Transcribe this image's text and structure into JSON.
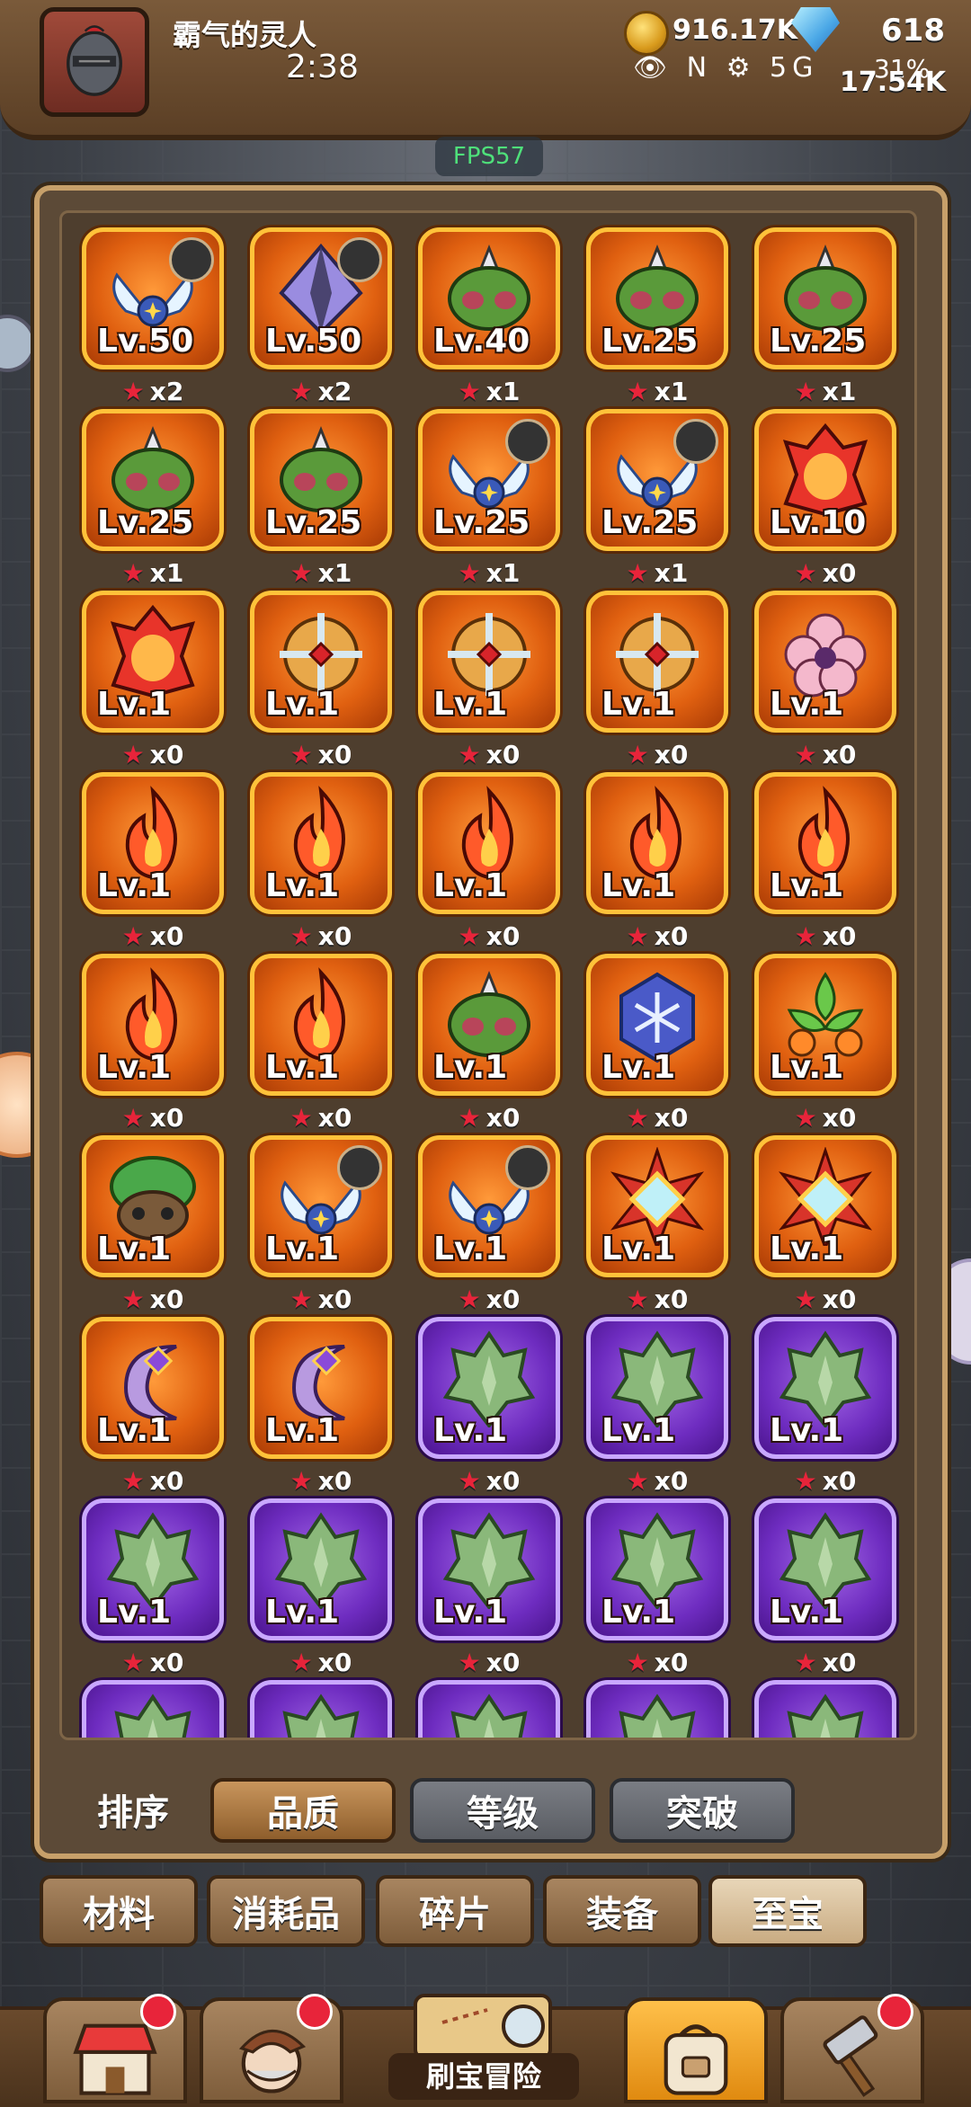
{
  "header": {
    "player_name": "霸气的灵人",
    "clock": "2:38",
    "gold": "916.17K",
    "gems": "618",
    "sub_resource": "17.54K",
    "status_icons": "👁 N ⚙ 5G",
    "battery": "31%"
  },
  "fps": "FPS57",
  "items": [
    {
      "lv": "Lv.50",
      "count": "x2",
      "rarity": "orange",
      "icon": "wing-relic-icon",
      "owner": true
    },
    {
      "lv": "Lv.50",
      "count": "x2",
      "rarity": "orange",
      "icon": "crystal-relic-icon",
      "owner": true
    },
    {
      "lv": "Lv.40",
      "count": "x1",
      "rarity": "orange",
      "icon": "green-mask-relic-icon",
      "owner": false
    },
    {
      "lv": "Lv.25",
      "count": "x1",
      "rarity": "orange",
      "icon": "green-mask-relic-icon",
      "owner": false
    },
    {
      "lv": "Lv.25",
      "count": "x1",
      "rarity": "orange",
      "icon": "green-mask-relic-icon",
      "owner": false
    },
    {
      "lv": "Lv.25",
      "count": "x1",
      "rarity": "orange",
      "icon": "green-mask-relic-icon",
      "owner": false
    },
    {
      "lv": "Lv.25",
      "count": "x1",
      "rarity": "orange",
      "icon": "green-mask-relic-icon",
      "owner": false
    },
    {
      "lv": "Lv.25",
      "count": "x1",
      "rarity": "orange",
      "icon": "wing-relic-icon",
      "owner": true
    },
    {
      "lv": "Lv.25",
      "count": "x1",
      "rarity": "orange",
      "icon": "wing-relic-icon",
      "owner": true
    },
    {
      "lv": "Lv.10",
      "count": "x0",
      "rarity": "orange",
      "icon": "flame-mask-relic-icon",
      "owner": false
    },
    {
      "lv": "Lv.1",
      "count": "x0",
      "rarity": "orange",
      "icon": "flame-mask-relic-icon",
      "owner": false
    },
    {
      "lv": "Lv.1",
      "count": "x0",
      "rarity": "orange",
      "icon": "cross-shield-relic-icon",
      "owner": false
    },
    {
      "lv": "Lv.1",
      "count": "x0",
      "rarity": "orange",
      "icon": "cross-shield-relic-icon",
      "owner": false
    },
    {
      "lv": "Lv.1",
      "count": "x0",
      "rarity": "orange",
      "icon": "cross-shield-relic-icon",
      "owner": false
    },
    {
      "lv": "Lv.1",
      "count": "x0",
      "rarity": "orange",
      "icon": "flower-relic-icon",
      "owner": false
    },
    {
      "lv": "Lv.1",
      "count": "x0",
      "rarity": "orange",
      "icon": "fire-relic-icon",
      "owner": false
    },
    {
      "lv": "Lv.1",
      "count": "x0",
      "rarity": "orange",
      "icon": "fire-relic-icon",
      "owner": false
    },
    {
      "lv": "Lv.1",
      "count": "x0",
      "rarity": "orange",
      "icon": "fire-relic-icon",
      "owner": false
    },
    {
      "lv": "Lv.1",
      "count": "x0",
      "rarity": "orange",
      "icon": "fire-relic-icon",
      "owner": false
    },
    {
      "lv": "Lv.1",
      "count": "x0",
      "rarity": "orange",
      "icon": "fire-relic-icon",
      "owner": false
    },
    {
      "lv": "Lv.1",
      "count": "x0",
      "rarity": "orange",
      "icon": "fire-relic-icon",
      "owner": false
    },
    {
      "lv": "Lv.1",
      "count": "x0",
      "rarity": "orange",
      "icon": "fire-relic-icon",
      "owner": false
    },
    {
      "lv": "Lv.1",
      "count": "x0",
      "rarity": "orange",
      "icon": "green-mask-relic-icon",
      "owner": false
    },
    {
      "lv": "Lv.1",
      "count": "x0",
      "rarity": "orange",
      "icon": "snowflake-relic-icon",
      "owner": false
    },
    {
      "lv": "Lv.1",
      "count": "x0",
      "rarity": "orange",
      "icon": "leaf-orb-relic-icon",
      "owner": false
    },
    {
      "lv": "Lv.1",
      "count": "x0",
      "rarity": "orange",
      "icon": "forest-mask-relic-icon",
      "owner": false
    },
    {
      "lv": "Lv.1",
      "count": "x0",
      "rarity": "orange",
      "icon": "wing-relic-icon",
      "owner": true
    },
    {
      "lv": "Lv.1",
      "count": "x0",
      "rarity": "orange",
      "icon": "wing-relic-icon",
      "owner": true
    },
    {
      "lv": "Lv.1",
      "count": "x0",
      "rarity": "orange",
      "icon": "diamond-star-relic-icon",
      "owner": false
    },
    {
      "lv": "Lv.1",
      "count": "x0",
      "rarity": "orange",
      "icon": "diamond-star-relic-icon",
      "owner": false
    },
    {
      "lv": "Lv.1",
      "count": "x0",
      "rarity": "orange",
      "icon": "moon-relic-icon",
      "owner": false
    },
    {
      "lv": "Lv.1",
      "count": "x0",
      "rarity": "orange",
      "icon": "moon-relic-icon",
      "owner": false
    },
    {
      "lv": "Lv.1",
      "count": "x0",
      "rarity": "purple",
      "icon": "dragon-head-relic-icon",
      "owner": false
    },
    {
      "lv": "Lv.1",
      "count": "x0",
      "rarity": "purple",
      "icon": "dragon-head-relic-icon",
      "owner": false
    },
    {
      "lv": "Lv.1",
      "count": "x0",
      "rarity": "purple",
      "icon": "dragon-head-relic-icon",
      "owner": false
    },
    {
      "lv": "Lv.1",
      "count": "x0",
      "rarity": "purple",
      "icon": "dragon-head-relic-icon",
      "owner": false
    },
    {
      "lv": "Lv.1",
      "count": "x0",
      "rarity": "purple",
      "icon": "dragon-head-relic-icon",
      "owner": false
    },
    {
      "lv": "Lv.1",
      "count": "x0",
      "rarity": "purple",
      "icon": "dragon-head-relic-icon",
      "owner": false
    },
    {
      "lv": "Lv.1",
      "count": "x0",
      "rarity": "purple",
      "icon": "dragon-head-relic-icon",
      "owner": false
    },
    {
      "lv": "Lv.1",
      "count": "x0",
      "rarity": "purple",
      "icon": "dragon-head-relic-icon",
      "owner": false
    },
    {
      "lv": "",
      "count": "",
      "rarity": "purple",
      "icon": "dragon-head-relic-icon",
      "owner": false
    },
    {
      "lv": "",
      "count": "",
      "rarity": "purple",
      "icon": "dragon-head-relic-icon",
      "owner": false
    },
    {
      "lv": "",
      "count": "",
      "rarity": "purple",
      "icon": "dragon-head-relic-icon",
      "owner": false
    },
    {
      "lv": "",
      "count": "",
      "rarity": "purple",
      "icon": "dragon-head-relic-icon",
      "owner": false
    },
    {
      "lv": "",
      "count": "",
      "rarity": "purple",
      "icon": "dragon-head-relic-icon",
      "owner": false
    }
  ],
  "sort": {
    "label": "排序",
    "buttons": [
      {
        "label": "品质",
        "active": true
      },
      {
        "label": "等级",
        "active": false
      },
      {
        "label": "突破",
        "active": false
      }
    ]
  },
  "categories": [
    {
      "label": "材料",
      "active": false
    },
    {
      "label": "消耗品",
      "active": false
    },
    {
      "label": "碎片",
      "active": false
    },
    {
      "label": "装备",
      "active": false
    },
    {
      "label": "至宝",
      "active": true
    }
  ],
  "bottom_nav": {
    "center_label": "刷宝冒险",
    "buttons": [
      {
        "name": "shop",
        "icon": "shop-icon",
        "badge": true,
        "active": false
      },
      {
        "name": "hero",
        "icon": "hero-icon",
        "badge": true,
        "active": false
      },
      {
        "name": "bag",
        "icon": "backpack-icon",
        "badge": false,
        "active": true
      },
      {
        "name": "forge",
        "icon": "hammer-icon",
        "badge": true,
        "active": false
      }
    ]
  },
  "colors": {
    "orange_tile": "#e06010",
    "purple_tile": "#6e2cc0",
    "star": "#e8243a",
    "fps": "#4ee07a"
  }
}
